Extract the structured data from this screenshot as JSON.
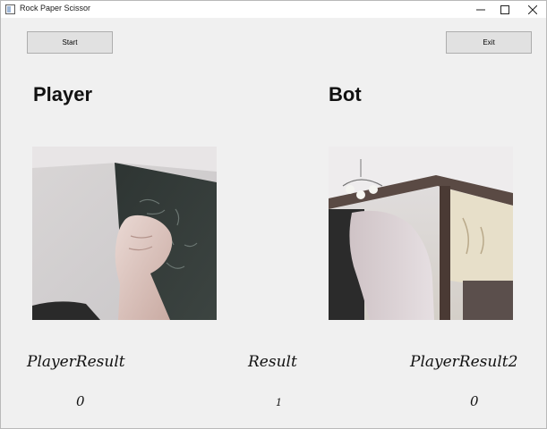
{
  "window": {
    "title": "Rock Paper Scissor",
    "icons": [
      "app-icon",
      "minimize-icon",
      "maximize-icon",
      "close-icon"
    ]
  },
  "toolbar": {
    "start_label": "Start",
    "exit_label": "Exit"
  },
  "panels": {
    "player_heading": "Player",
    "bot_heading": "Bot"
  },
  "results": {
    "player_label": "PlayerResult",
    "result_label": "Result",
    "player2_label": "PlayerResult2",
    "player_value": "0",
    "result_value": "1",
    "player2_value": "0"
  }
}
